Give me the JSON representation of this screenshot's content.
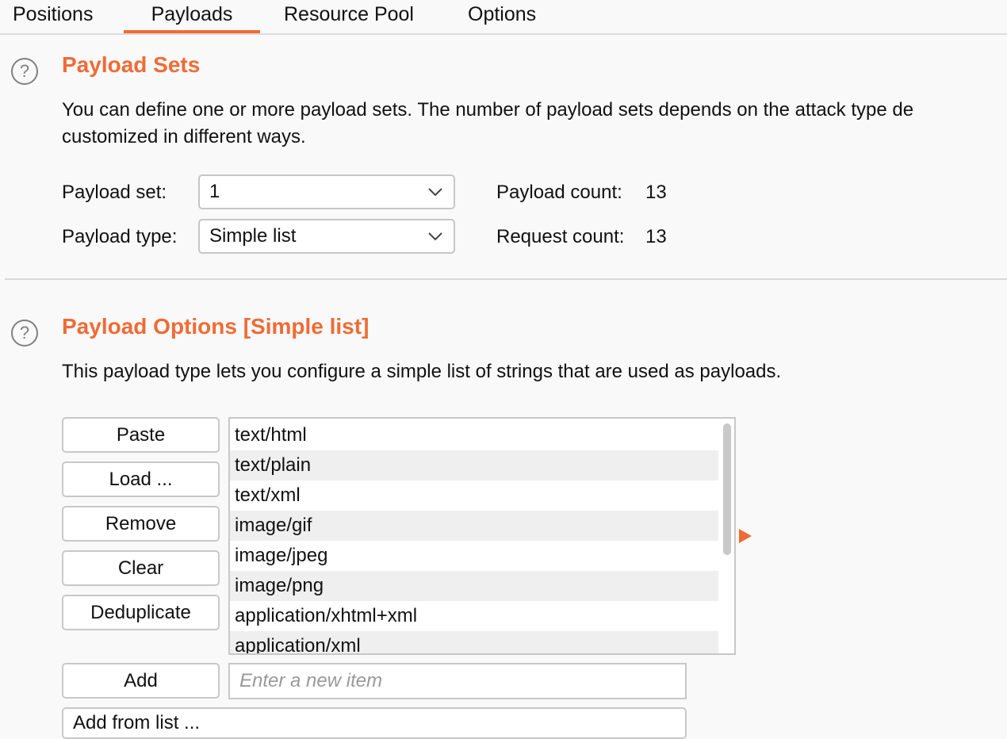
{
  "tabs": [
    {
      "label": "Positions"
    },
    {
      "label": "Payloads"
    },
    {
      "label": "Resource Pool"
    },
    {
      "label": "Options"
    }
  ],
  "active_tab": "Payloads",
  "accent_color": "#ef6b35",
  "payload_sets": {
    "help_icon": "?",
    "title": "Payload Sets",
    "desc_line1": "You can define one or more payload sets. The number of payload sets depends on the attack type de",
    "desc_line2": "customized in different ways.",
    "payload_set_label": "Payload set:",
    "payload_set_value": "1",
    "payload_type_label": "Payload type:",
    "payload_type_value": "Simple list",
    "payload_count_label": "Payload count:",
    "payload_count_value": "13",
    "request_count_label": "Request count:",
    "request_count_value": "13"
  },
  "payload_options": {
    "help_icon": "?",
    "title": "Payload Options [Simple list]",
    "desc": "This payload type lets you configure a simple list of strings that are used as payloads.",
    "buttons": {
      "paste": "Paste",
      "load": "Load ...",
      "remove": "Remove",
      "clear": "Clear",
      "deduplicate": "Deduplicate",
      "add": "Add"
    },
    "list_items": [
      "text/html",
      "text/plain",
      "text/xml",
      "image/gif",
      "image/jpeg",
      "image/png",
      "application/xhtml+xml",
      "application/xml"
    ],
    "add_placeholder": "Enter a new item",
    "add_from_list_label": "Add from list ..."
  }
}
